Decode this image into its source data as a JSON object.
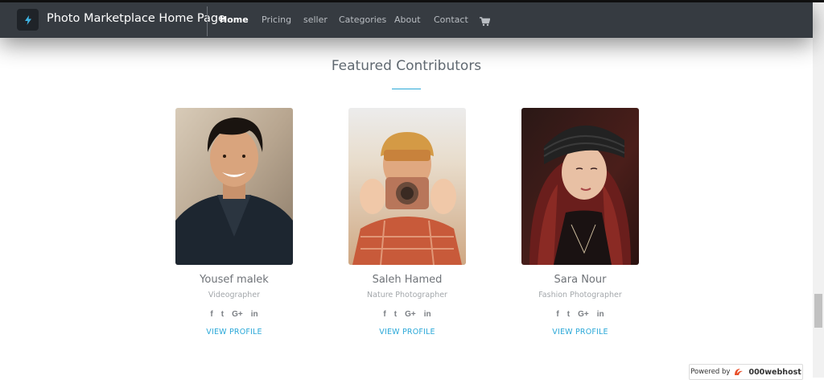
{
  "navbar": {
    "logo_icon": "lightning-logo-icon",
    "brand": "Photo Marketplace Home Page",
    "items": [
      {
        "label": "Home",
        "active": true
      },
      {
        "label": "Pricing",
        "active": false
      },
      {
        "label": "seller",
        "active": false
      },
      {
        "label": "Categories",
        "active": false
      },
      {
        "label": "About",
        "active": false
      },
      {
        "label": "Contact",
        "active": false
      }
    ],
    "cart_icon": "shopping-cart-icon"
  },
  "section": {
    "title": "Featured Contributors",
    "accent_color": "#2aa8d8"
  },
  "contributors": [
    {
      "name": "Yousef malek",
      "role": "Videographer",
      "link": "VIEW PROFILE",
      "photo": "young-man-black-jacket-portrait"
    },
    {
      "name": "Saleh Hamed",
      "role": "Nature Photographer",
      "link": "VIEW PROFILE",
      "photo": "man-holding-camera-plaid-shirt"
    },
    {
      "name": "Sara Nour",
      "role": "Fashion Photographer",
      "link": "VIEW PROFILE",
      "photo": "woman-black-beanie-red-hair"
    }
  ],
  "social_icons": [
    {
      "name": "facebook-icon",
      "glyph": "f"
    },
    {
      "name": "twitter-icon",
      "glyph": "t"
    },
    {
      "name": "google-plus-icon",
      "glyph": "G+"
    },
    {
      "name": "linkedin-icon",
      "glyph": "in"
    }
  ],
  "footer_badge": {
    "prefix": "Powered by",
    "host": "000webhost"
  }
}
